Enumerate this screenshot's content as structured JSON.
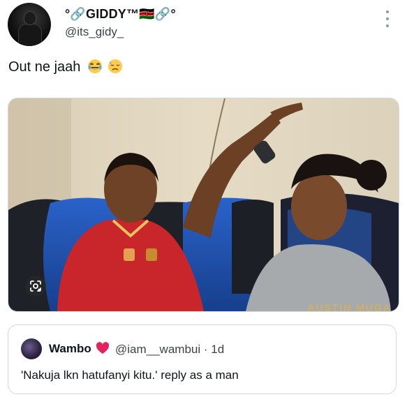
{
  "tweet": {
    "display_name": "°🔗GIDDY™🇰🇪🔗°",
    "handle": "@its_gidy_",
    "text": "Out ne jaah",
    "text_emojis": [
      "laughing-emoji",
      "downcast-sweat-emoji"
    ],
    "more_icon": "more-vertical-icon"
  },
  "media": {
    "watermark": "AUSTIN MUGA",
    "lens_icon": "google-lens-icon"
  },
  "quoted": {
    "display_name": "Wambo",
    "name_emoji": "red-heart",
    "handle_time": "@iam__wambui · 1d",
    "text": "'Nakuja lkn hatufanyi kitu.' reply as a man"
  },
  "colors": {
    "text": "#0f1419",
    "secondary": "#536471",
    "border": "#cfd9de",
    "heart": "#e0245e"
  }
}
